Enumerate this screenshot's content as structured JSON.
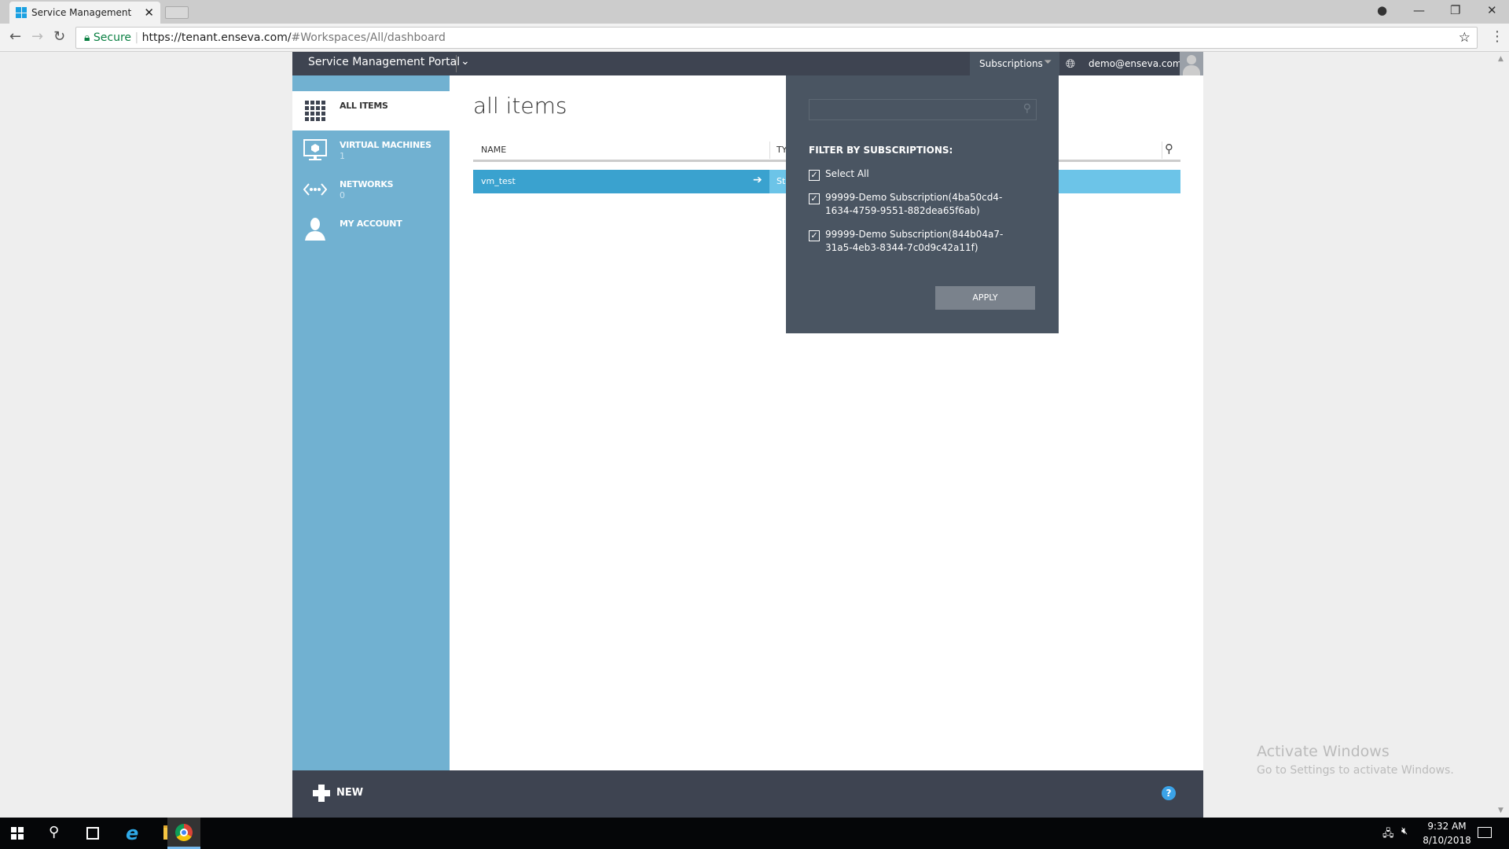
{
  "browser": {
    "tab_title": "Service Management",
    "secure_label": "Secure",
    "url_host": "https://tenant.enseva.com/",
    "url_path": "#Workspaces/All/dashboard"
  },
  "portal": {
    "title": "Service Management Portal",
    "subscriptions_label": "Subscriptions",
    "user_email": "demo@enseva.com"
  },
  "sidebar": {
    "items": [
      {
        "label": "ALL ITEMS",
        "count": "",
        "icon": "grid-icon",
        "active": true
      },
      {
        "label": "VIRTUAL MACHINES",
        "count": "1",
        "icon": "monitor-icon"
      },
      {
        "label": "NETWORKS",
        "count": "0",
        "icon": "network-icon"
      },
      {
        "label": "MY ACCOUNT",
        "count": "",
        "icon": "user-icon"
      }
    ]
  },
  "main": {
    "title": "all items",
    "columns": [
      "NAME",
      "TYPE"
    ],
    "rows": [
      {
        "name": "vm_test",
        "type": "Sta"
      }
    ]
  },
  "filter": {
    "search_placeholder": "",
    "heading": "FILTER BY SUBSCRIPTIONS:",
    "options": [
      {
        "label": "Select All",
        "checked": true
      },
      {
        "label": "99999-Demo Subscription(4ba50cd4-",
        "label2": "1634-4759-9551-882dea65f6ab)",
        "checked": true
      },
      {
        "label": "99999-Demo Subscription(844b04a7-",
        "label2": "31a5-4eb3-8344-7c0d9c42a11f)",
        "checked": true
      }
    ],
    "apply_label": "APPLY"
  },
  "bottom": {
    "new_label": "NEW"
  },
  "watermark": {
    "line1": "Activate Windows",
    "line2": "Go to Settings to activate Windows."
  },
  "taskbar": {
    "time": "9:32 AM",
    "date": "8/10/2018"
  },
  "colors": {
    "header": "#3e4451",
    "sidebar": "#71b1d1",
    "row_selected": "#3aa2cf",
    "row_highlight": "#6cc4e8",
    "popup": "#4a5562"
  }
}
